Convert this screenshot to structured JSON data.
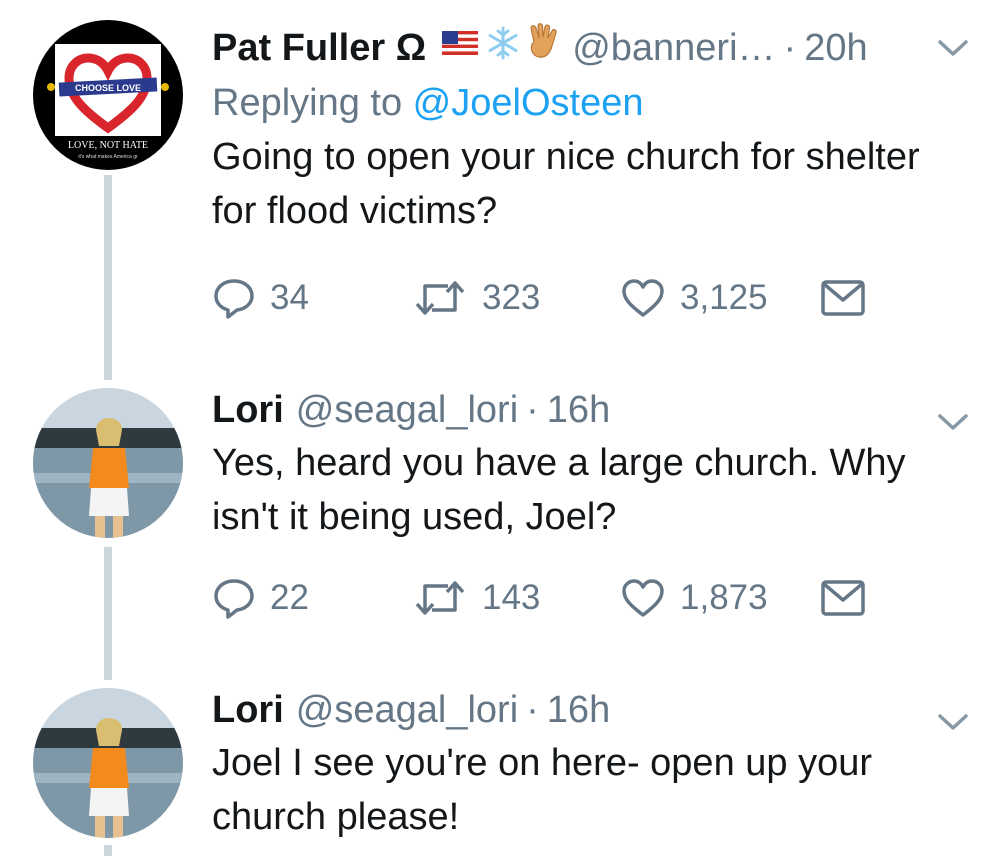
{
  "tweets": [
    {
      "name": "Pat Fuller Ω",
      "handle": "@banneri…",
      "time": "20h",
      "reply_prefix": "Replying to ",
      "reply_handle": "@JoelOsteen",
      "text": "Going to open your nice church for shelter for flood victims?",
      "replies": "34",
      "retweets": "323",
      "likes": "3,125",
      "avatar": {
        "banner_text": "CHOOSE LOVE",
        "caption": "LOVE, NOT HATE",
        "subcaption": "it's what makes America gr"
      },
      "emojis": [
        "us-flag-icon",
        "snowflake-icon",
        "vulcan-salute-icon"
      ]
    },
    {
      "name": "Lori",
      "handle": "@seagal_lori",
      "time": "16h",
      "text": "Yes, heard you have a large church. Why isn't it being used, Joel?",
      "replies": "22",
      "retweets": "143",
      "likes": "1,873"
    },
    {
      "name": "Lori",
      "handle": "@seagal_lori",
      "time": "16h",
      "text": "Joel I see you're on here- open up your church please!"
    }
  ],
  "colors": {
    "link": "#1da1f2",
    "muted": "#657786",
    "text": "#14171a",
    "thread": "#ccd6dd"
  },
  "icons": [
    "reply-icon",
    "retweet-icon",
    "like-icon",
    "dm-icon",
    "chevron-down-icon"
  ]
}
